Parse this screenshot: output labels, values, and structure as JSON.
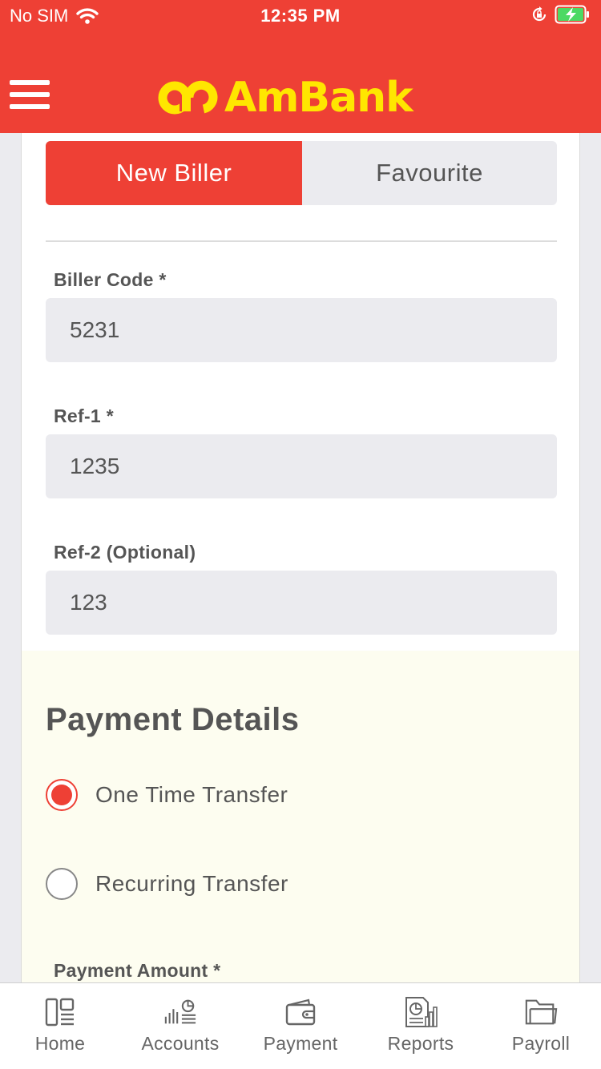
{
  "status_bar": {
    "carrier": "No SIM",
    "time": "12:35 PM"
  },
  "header": {
    "brand": "AmBank"
  },
  "tabs": [
    {
      "label": "New Biller",
      "active": true
    },
    {
      "label": "Favourite",
      "active": false
    }
  ],
  "fields": {
    "biller_code": {
      "label": "Biller Code *",
      "value": "5231"
    },
    "ref1": {
      "label": "Ref-1 *",
      "value": "1235"
    },
    "ref2": {
      "label": "Ref-2 (Optional)",
      "value": "123"
    }
  },
  "payment_details": {
    "title": "Payment Details",
    "options": [
      {
        "label": "One Time Transfer",
        "selected": true
      },
      {
        "label": "Recurring Transfer",
        "selected": false
      }
    ],
    "amount_label": "Payment Amount *"
  },
  "bottom_nav": [
    {
      "label": "Home",
      "icon": "home-icon"
    },
    {
      "label": "Accounts",
      "icon": "accounts-icon"
    },
    {
      "label": "Payment",
      "icon": "wallet-icon"
    },
    {
      "label": "Reports",
      "icon": "reports-icon"
    },
    {
      "label": "Payroll",
      "icon": "folder-icon"
    }
  ],
  "colors": {
    "brand_red": "#ee4035",
    "brand_yellow": "#ffe600",
    "field_bg": "#ebebef",
    "section_bg": "#fdfdf0"
  }
}
